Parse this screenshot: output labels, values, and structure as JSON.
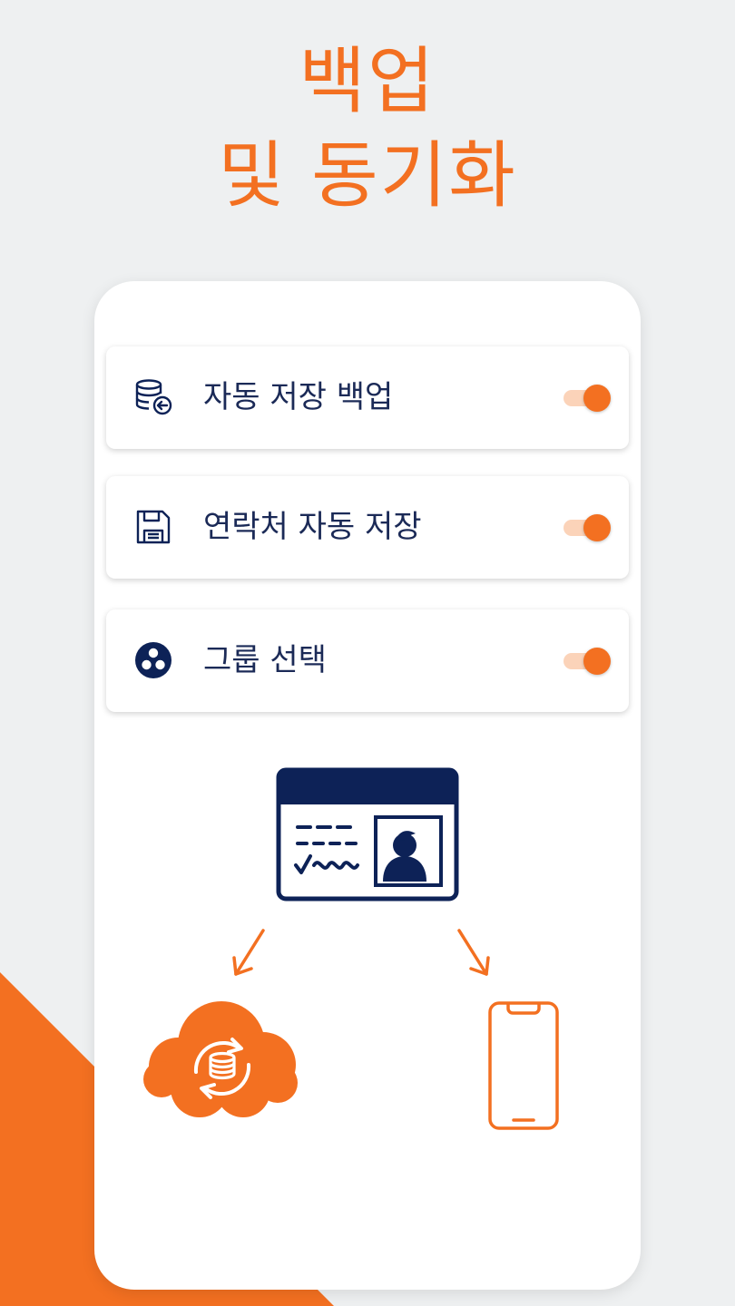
{
  "headline": {
    "line1": "백업",
    "line2": "및 동기화"
  },
  "settings": [
    {
      "label": "자동 저장 백업",
      "icon": "database-backup-icon",
      "enabled": true
    },
    {
      "label": "연락처 자동 저장",
      "icon": "floppy-disk-icon",
      "enabled": true
    },
    {
      "label": "그룹 선택",
      "icon": "group-dots-icon",
      "enabled": true
    }
  ],
  "illustration": {
    "card_icon": "id-card-icon",
    "cloud_icon": "cloud-sync-icon",
    "phone_icon": "smartphone-icon"
  },
  "colors": {
    "accent": "#f37021",
    "navy": "#0d2257",
    "toggle_track": "#fbd3b9"
  }
}
